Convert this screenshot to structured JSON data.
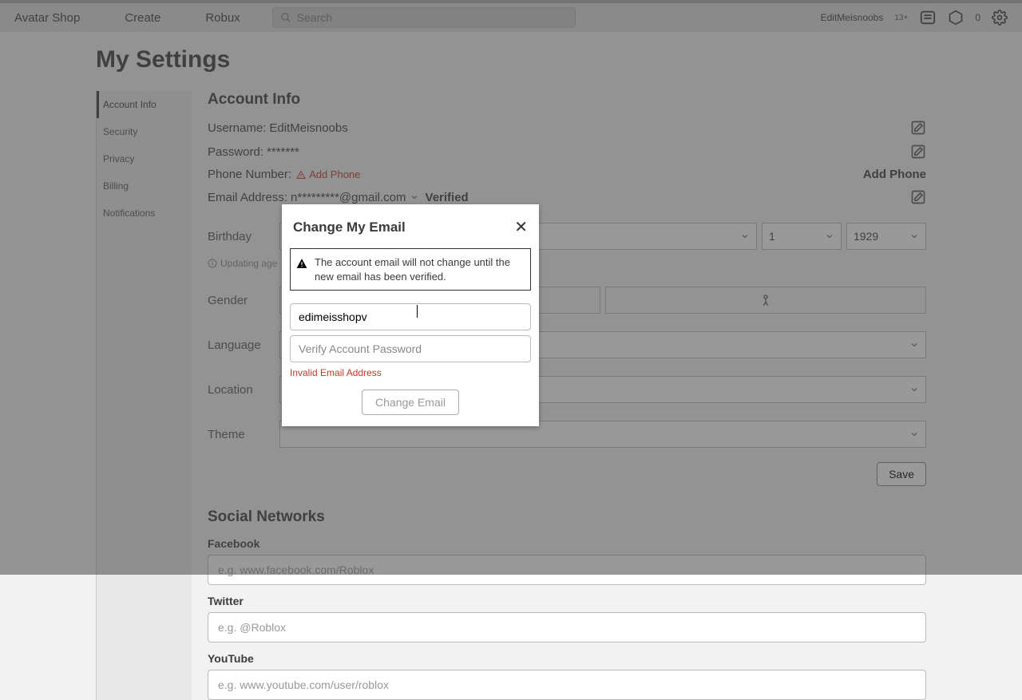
{
  "topbar": {
    "nav": [
      "Avatar Shop",
      "Create",
      "Robux"
    ],
    "search_placeholder": "Search",
    "user": "EditMeisnoobs",
    "age_tag": "13+",
    "robux_count": "0"
  },
  "page_title": "My Settings",
  "sidebar": {
    "items": [
      {
        "label": "Account Info",
        "active": true
      },
      {
        "label": "Security"
      },
      {
        "label": "Privacy"
      },
      {
        "label": "Billing"
      },
      {
        "label": "Notifications"
      }
    ]
  },
  "account_info": {
    "heading": "Account Info",
    "username_label": "Username:",
    "username": "EditMeisnoobs",
    "password_label": "Password:",
    "password": "*******",
    "phone_label": "Phone Number:",
    "add_phone": "Add Phone",
    "add_phone_right": "Add Phone",
    "email_label": "Email Address:",
    "email": "n*********@gmail.com",
    "verified": "Verified",
    "birthday_label": "Birthday",
    "birthday": {
      "month": "",
      "day": "1",
      "year": "1929"
    },
    "updating_age": "Updating age",
    "gender_label": "Gender",
    "language_label": "Language",
    "language_value": "",
    "location_label": "Location",
    "location_value": "",
    "theme_label": "Theme",
    "theme_value": "",
    "save": "Save"
  },
  "social": {
    "heading": "Social Networks",
    "facebook_label": "Facebook",
    "facebook_placeholder": "e.g. www.facebook.com/Roblox",
    "twitter_label": "Twitter",
    "twitter_placeholder": "e.g. @Roblox",
    "youtube_label": "YouTube",
    "youtube_placeholder": "e.g. www.youtube.com/user/roblox"
  },
  "modal": {
    "title": "Change My Email",
    "alert": "The account email will not change until the new email has been verified.",
    "email_value": "edimeisshopv",
    "password_placeholder": "Verify Account Password",
    "error": "Invalid Email Address",
    "button": "Change Email"
  }
}
